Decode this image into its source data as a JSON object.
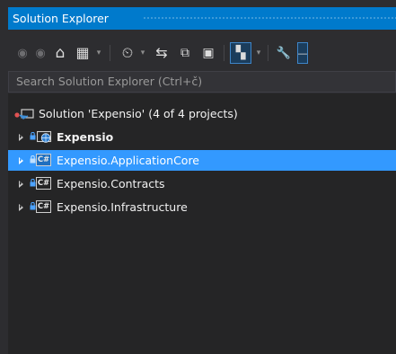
{
  "panel": {
    "title": "Solution Explorer",
    "search_placeholder": "Search Solution Explorer (Ctrl+č)"
  },
  "toolbar": {
    "buttons": [
      {
        "icon": "back-icon",
        "glyph": "◉",
        "enabled": false
      },
      {
        "icon": "forward-icon",
        "glyph": "◉",
        "enabled": false
      },
      {
        "icon": "home-icon",
        "glyph": "⌂"
      },
      {
        "icon": "switch-views-icon",
        "glyph": "▦"
      },
      {
        "icon": "pending-changes-filter-icon",
        "glyph": "⏲"
      },
      {
        "icon": "sync-with-active-document-icon",
        "glyph": "⇆"
      },
      {
        "icon": "collapse-all-icon",
        "glyph": "⧉"
      },
      {
        "icon": "show-all-files-icon",
        "glyph": "▣"
      },
      {
        "icon": "preview-selected-items-icon",
        "glyph": "▚"
      },
      {
        "icon": "properties-wrench-icon",
        "glyph": "🔧"
      }
    ],
    "dropdown_glyph": "▾"
  },
  "tree": {
    "solution": {
      "label": "Solution 'Expensio' (4 of 4 projects)",
      "icon": "solution-icon"
    },
    "projects": [
      {
        "label": "Expensio",
        "icon": "web-project-icon",
        "bold": true,
        "selected": false
      },
      {
        "label": "Expensio.ApplicationCore",
        "icon": "csharp-project-icon",
        "bold": false,
        "selected": true
      },
      {
        "label": "Expensio.Contracts",
        "icon": "csharp-project-icon",
        "bold": false,
        "selected": false
      },
      {
        "label": "Expensio.Infrastructure",
        "icon": "csharp-project-icon",
        "bold": false,
        "selected": false
      }
    ],
    "csharp_badge": "C#"
  },
  "colors": {
    "accent": "#007acc",
    "selection": "#3399ff",
    "background": "#252526"
  }
}
